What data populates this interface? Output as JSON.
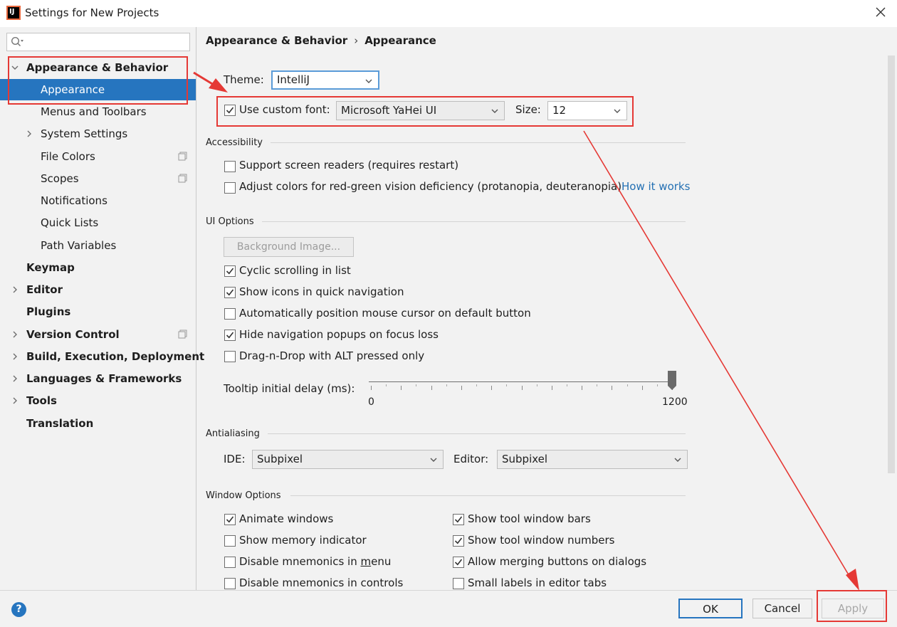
{
  "window": {
    "title": "Settings for New Projects",
    "logo_text": "IJ"
  },
  "search": {
    "placeholder": "",
    "value": ""
  },
  "sidebar": {
    "items": [
      {
        "label": "Appearance & Behavior"
      },
      {
        "label": "Appearance"
      },
      {
        "label": "Menus and Toolbars"
      },
      {
        "label": "System Settings"
      },
      {
        "label": "File Colors"
      },
      {
        "label": "Scopes"
      },
      {
        "label": "Notifications"
      },
      {
        "label": "Quick Lists"
      },
      {
        "label": "Path Variables"
      },
      {
        "label": "Keymap"
      },
      {
        "label": "Editor"
      },
      {
        "label": "Plugins"
      },
      {
        "label": "Version Control"
      },
      {
        "label": "Build, Execution, Deployment"
      },
      {
        "label": "Languages & Frameworks"
      },
      {
        "label": "Tools"
      },
      {
        "label": "Translation"
      }
    ]
  },
  "breadcrumb": {
    "parent": "Appearance & Behavior",
    "separator": "›",
    "current": "Appearance"
  },
  "theme": {
    "label": "Theme:",
    "value": "IntelliJ"
  },
  "font": {
    "checkbox_label": "Use custom font:",
    "checked": true,
    "value": "Microsoft YaHei UI",
    "size_label": "Size:",
    "size_value": "12"
  },
  "accessibility": {
    "title": "Accessibility",
    "screen_readers": "Support screen readers (requires restart)",
    "color_deficiency": "Adjust colors for red-green vision deficiency (protanopia, deuteranopia)",
    "how_it_works": "How it works"
  },
  "ui_options": {
    "title": "UI Options",
    "background_image_button": "Background Image...",
    "cyclic_scrolling": "Cyclic scrolling in list",
    "show_icons": "Show icons in quick navigation",
    "auto_position_mouse": "Automatically position mouse cursor on default button",
    "hide_nav_popups": "Hide navigation popups on focus loss",
    "drag_n_drop_alt": "Drag-n-Drop with ALT pressed only",
    "tooltip_delay_label": "Tooltip initial delay (ms):",
    "tooltip_min": "0",
    "tooltip_max": "1200",
    "tooltip_value": 1200
  },
  "antialiasing": {
    "title": "Antialiasing",
    "ide_label": "IDE:",
    "ide_value": "Subpixel",
    "editor_label": "Editor:",
    "editor_value": "Subpixel"
  },
  "window_options": {
    "title": "Window Options",
    "animate_windows": "Animate windows",
    "show_memory_indicator": "Show memory indicator",
    "disable_mnemonics_menu_prefix": "Disable mnemonics in ",
    "disable_mnemonics_menu_underlined": "m",
    "disable_mnemonics_menu_suffix": "enu",
    "disable_mnemonics_controls": "Disable mnemonics in controls",
    "show_tool_window_bars": "Show tool window bars",
    "show_tool_window_numbers": "Show tool window numbers",
    "allow_merging_buttons": "Allow merging buttons on dialogs",
    "small_labels_editor_tabs": "Small labels in editor tabs"
  },
  "buttons": {
    "help": "?",
    "ok": "OK",
    "cancel": "Cancel",
    "apply": "Apply"
  },
  "colors": {
    "selection": "#2675bf",
    "link": "#2470b3",
    "annotation": "#e53935"
  }
}
